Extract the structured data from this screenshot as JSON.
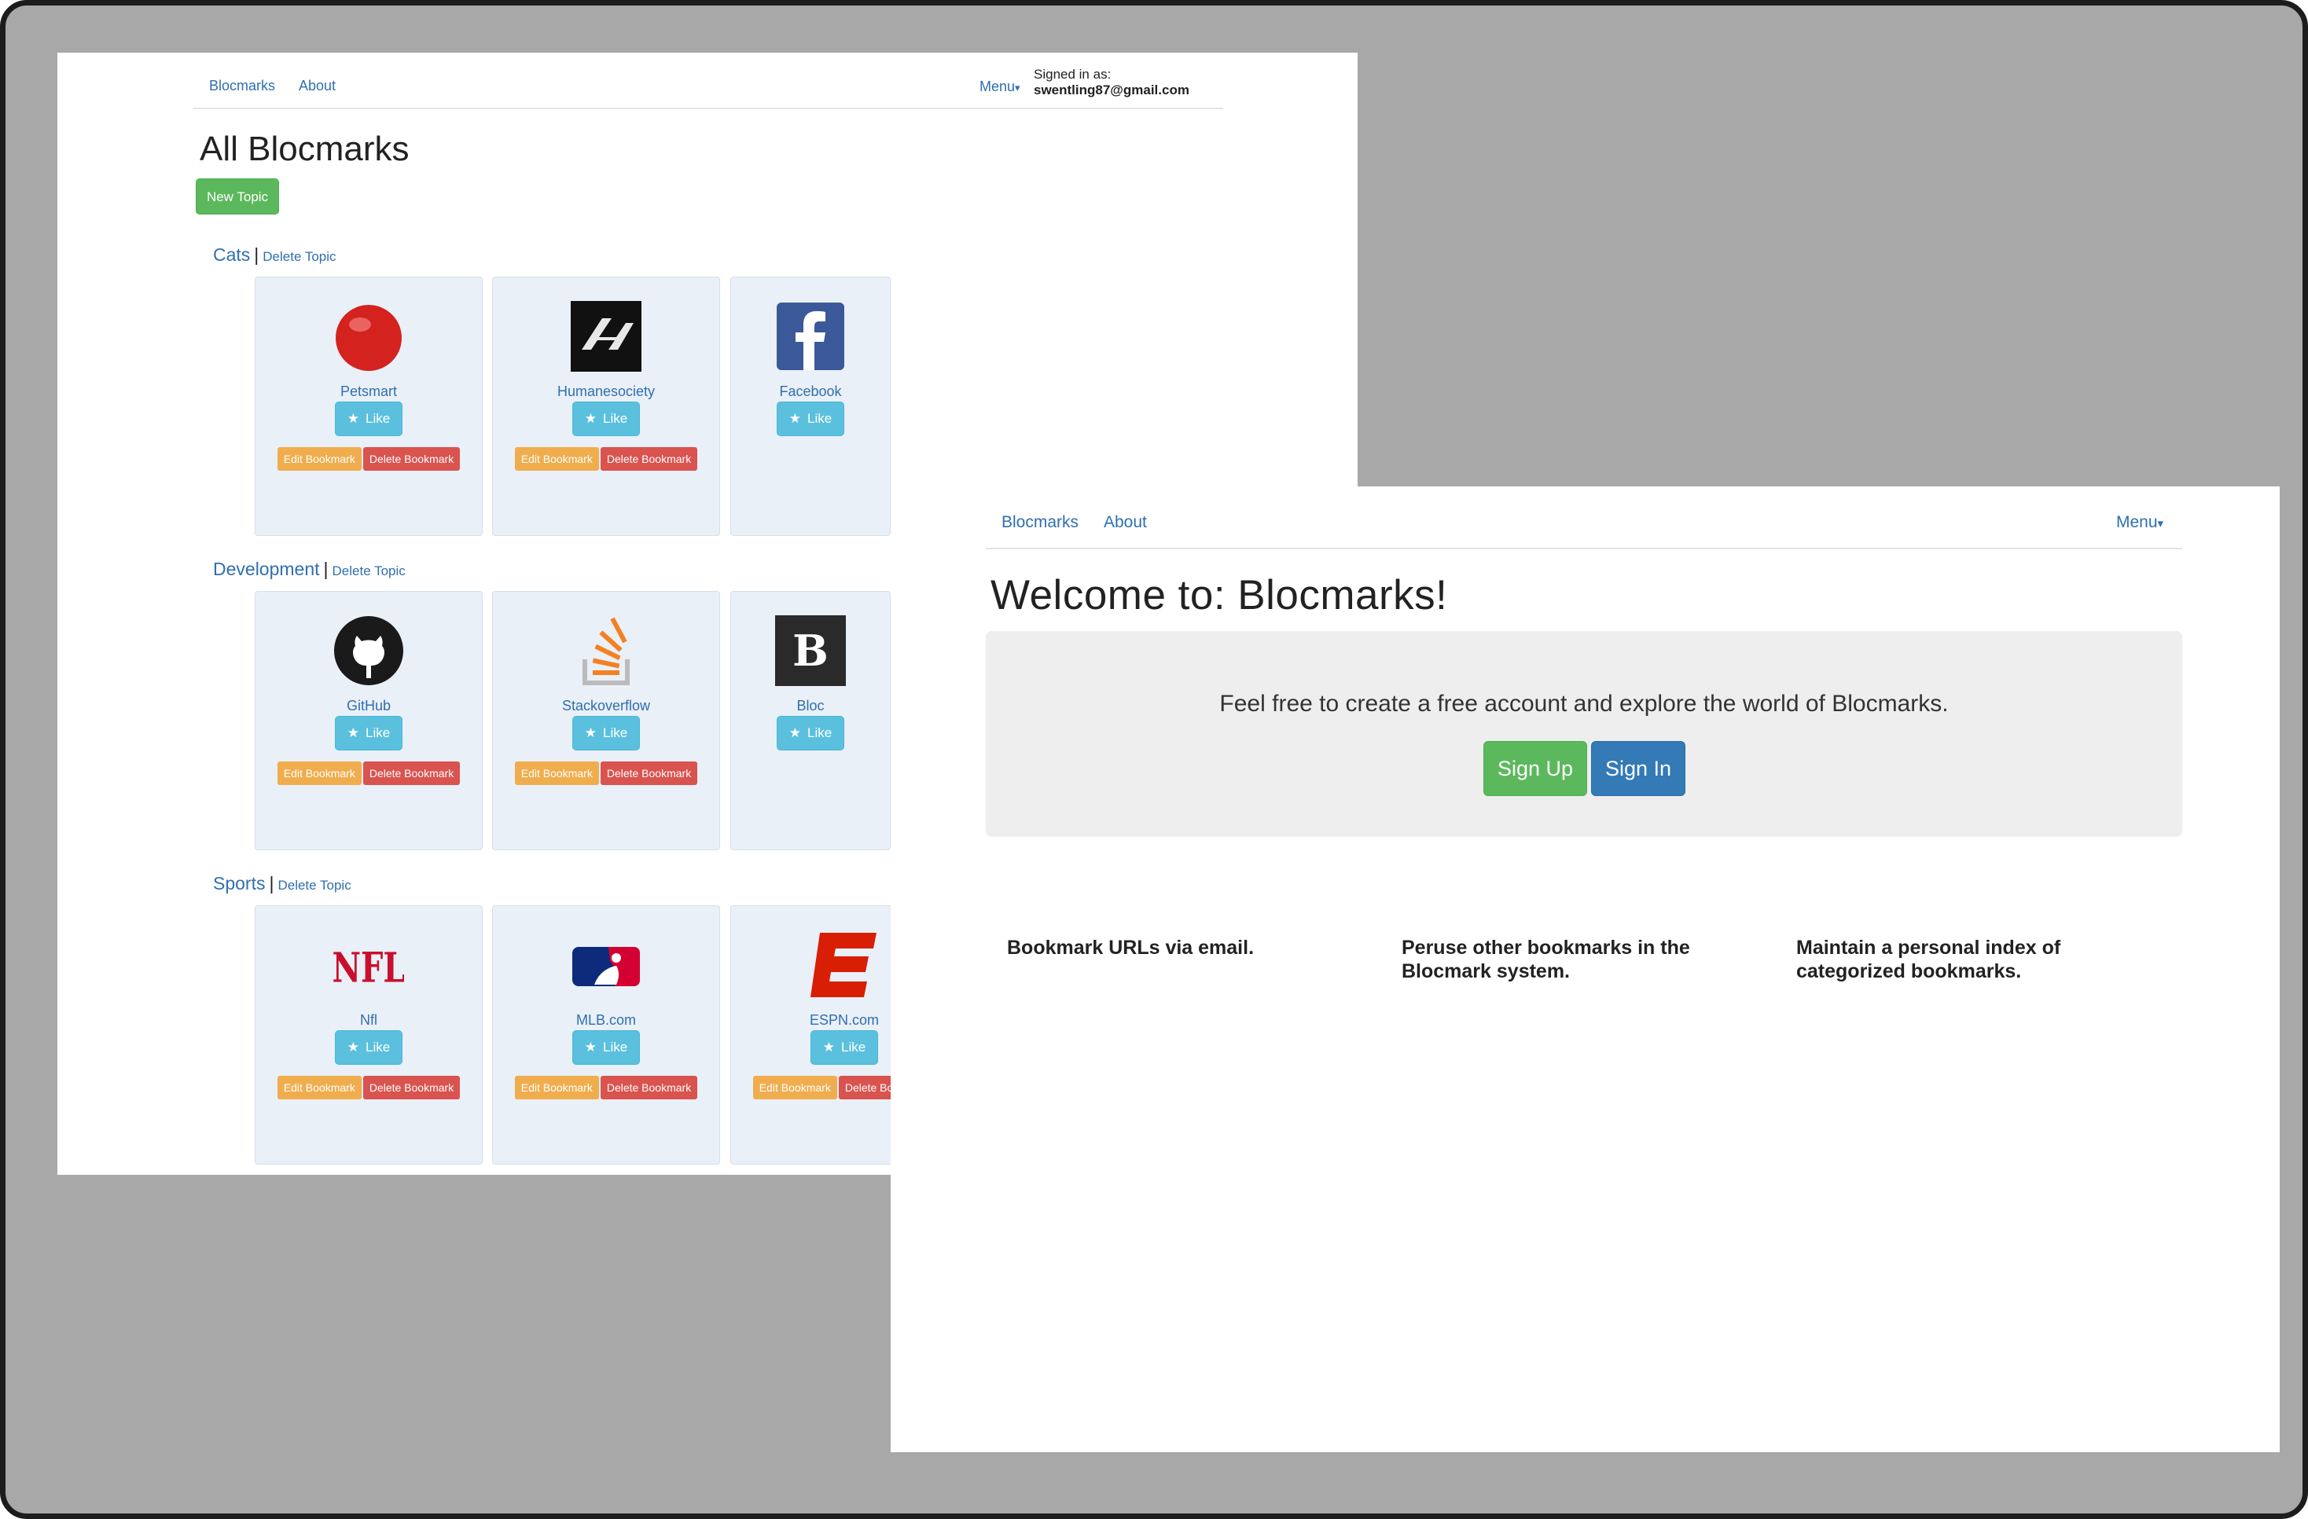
{
  "back_window": {
    "nav": {
      "brand": "Blocmarks",
      "about": "About",
      "menu": "Menu",
      "caret": "▾"
    },
    "signed_in_prefix": "Signed in as:",
    "signed_in_email": "swentling87@gmail.com",
    "title": "All Blocmarks",
    "new_topic": "New Topic",
    "topics": [
      {
        "name": "Cats",
        "sep": "|",
        "delete": "Delete Topic",
        "bookmarks": [
          {
            "name": "Petsmart",
            "icon": "petsmart-logo",
            "like": "Like",
            "edit": "Edit Bookmark",
            "delete": "Delete Bookmark"
          },
          {
            "name": "Humanesociety",
            "icon": "humanesociety-logo",
            "like": "Like",
            "edit": "Edit Bookmark",
            "delete": "Delete Bookmark"
          },
          {
            "name": "Facebook",
            "icon": "facebook-logo",
            "like": "Like"
          }
        ]
      },
      {
        "name": "Development",
        "sep": "|",
        "delete": "Delete Topic",
        "bookmarks": [
          {
            "name": "GitHub",
            "icon": "github-logo",
            "like": "Like",
            "edit": "Edit Bookmark",
            "delete": "Delete Bookmark"
          },
          {
            "name": "Stackoverflow",
            "icon": "stackoverflow-logo",
            "like": "Like",
            "edit": "Edit Bookmark",
            "delete": "Delete Bookmark"
          },
          {
            "name": "Bloc",
            "icon": "bloc-logo",
            "like": "Like"
          }
        ]
      },
      {
        "name": "Sports",
        "sep": "|",
        "delete": "Delete Topic",
        "bookmarks": [
          {
            "name": "Nfl",
            "icon": "nfl-logo",
            "like": "Like",
            "edit": "Edit Bookmark",
            "delete": "Delete Bookmark"
          },
          {
            "name": "MLB.com",
            "icon": "mlb-logo",
            "like": "Like",
            "edit": "Edit Bookmark",
            "delete": "Delete Bookmark"
          },
          {
            "name": "ESPN.com",
            "icon": "espn-logo",
            "like": "Like",
            "edit": "Edit Bookmark",
            "delete": "Delete Bookmark"
          }
        ]
      }
    ]
  },
  "front_window": {
    "nav": {
      "brand": "Blocmarks",
      "about": "About",
      "menu": "Menu",
      "caret": "▾"
    },
    "title": "Welcome to: Blocmarks!",
    "lead": "Feel free to create a free account and explore the world of Blocmarks.",
    "sign_up": "Sign Up",
    "sign_in": "Sign In",
    "features": [
      "Bookmark URLs via email.",
      "Peruse other bookmarks in the Blocmark system.",
      "Maintain a personal index of categorized bookmarks."
    ]
  },
  "icons": {
    "like_star": "★"
  },
  "colors": {
    "link": "#2f6fb0",
    "success": "#5cb85c",
    "info": "#5bc0de",
    "warning": "#f0ad4e",
    "danger": "#d9534f",
    "primary": "#337ab7"
  }
}
